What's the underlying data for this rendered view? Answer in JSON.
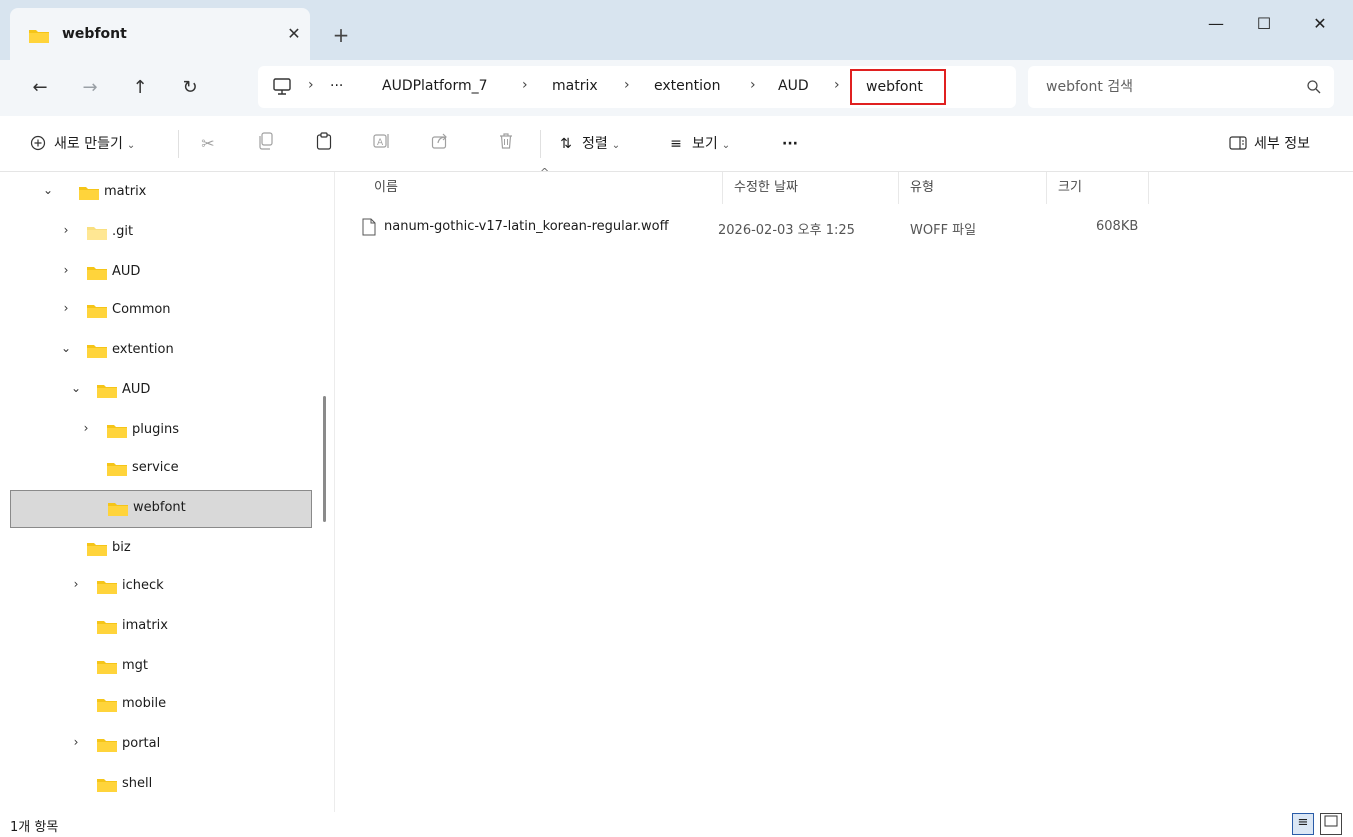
{
  "tab": {
    "title": "webfont",
    "close": "✕",
    "new_tab": "+"
  },
  "window": {
    "minimize": "—",
    "maximize": "☐",
    "close": "✕"
  },
  "nav": {
    "back": "←",
    "forward": "→",
    "up": "↑",
    "refresh": "↻"
  },
  "breadcrumb": {
    "overflow": "···",
    "items": [
      "AUDPlatform_7",
      "matrix",
      "extention",
      "AUD"
    ],
    "current": "webfont",
    "separator": "›"
  },
  "search": {
    "placeholder": "webfont 검색"
  },
  "toolbar": {
    "new_label": "새로 만들기",
    "sort_label": "정렬",
    "view_label": "보기",
    "more_label": "···",
    "details_label": "세부 정보",
    "chevron": "⌄"
  },
  "sidebar": {
    "items": [
      {
        "label": "matrix",
        "chevron": "⌄"
      },
      {
        "label": ".git",
        "chevron": "›"
      },
      {
        "label": "AUD",
        "chevron": "›"
      },
      {
        "label": "Common",
        "chevron": "›"
      },
      {
        "label": "extention",
        "chevron": "⌄"
      },
      {
        "label": "AUD",
        "chevron": "⌄"
      },
      {
        "label": "plugins",
        "chevron": "›"
      },
      {
        "label": "service",
        "chevron": ""
      },
      {
        "label": "webfont",
        "chevron": ""
      },
      {
        "label": "biz",
        "chevron": ""
      },
      {
        "label": "icheck",
        "chevron": "›"
      },
      {
        "label": "imatrix",
        "chevron": ""
      },
      {
        "label": "mgt",
        "chevron": ""
      },
      {
        "label": "mobile",
        "chevron": ""
      },
      {
        "label": "portal",
        "chevron": "›"
      },
      {
        "label": "shell",
        "chevron": ""
      }
    ]
  },
  "columns": {
    "name": "이름",
    "modified": "수정한 날짜",
    "type": "유형",
    "size": "크기",
    "sort_indicator": "^"
  },
  "files": [
    {
      "name": "nanum-gothic-v17-latin_korean-regular.woff",
      "modified": "2026-02-03 오후 1:25",
      "type": "WOFF 파일",
      "size": "608KB"
    }
  ],
  "status": {
    "count": "1개 항목"
  },
  "colors": {
    "folder": "#f5c518",
    "accent": "#2a5ca8",
    "highlight_border": "#e02020",
    "selected_bg": "#d9d9d9"
  }
}
